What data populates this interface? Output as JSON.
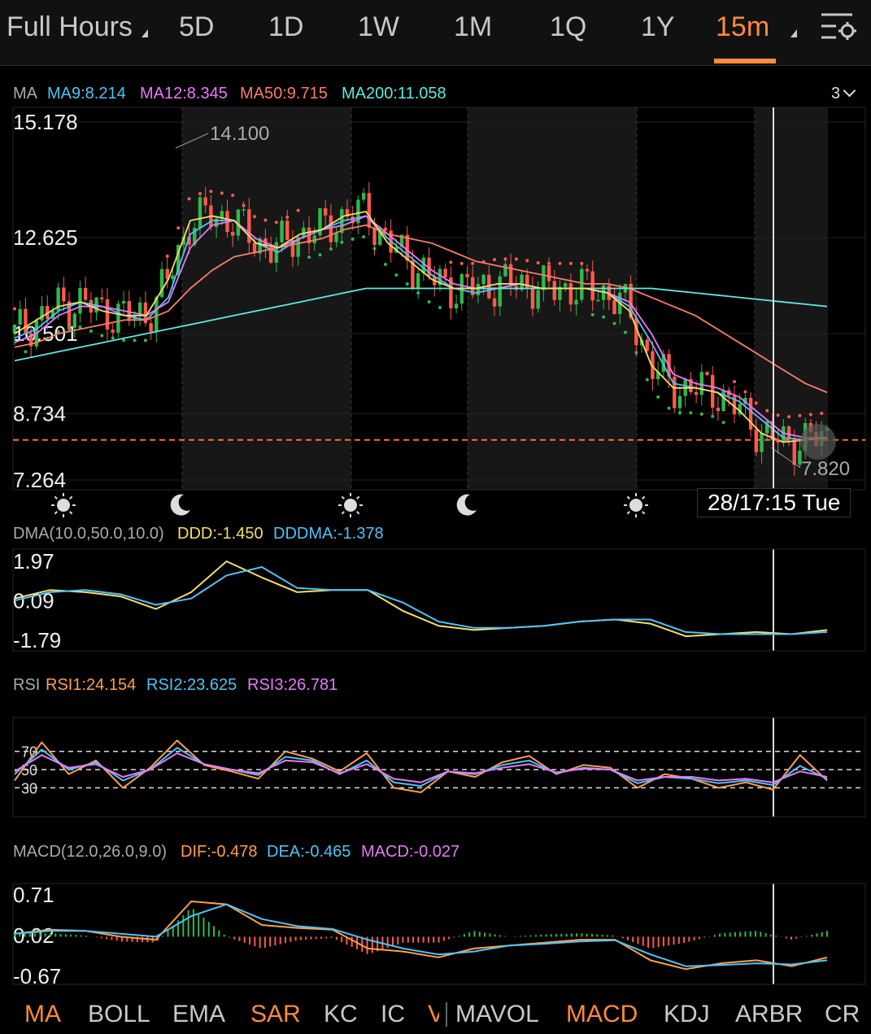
{
  "topbar": {
    "timeframes": [
      "Full Hours",
      "5D",
      "1D",
      "1W",
      "1M",
      "1Q",
      "1Y",
      "15m"
    ],
    "active": "15m",
    "accent": "#ff8a3d",
    "settings_icon": "settings-gear-icon"
  },
  "ma_panel": {
    "label": "MA",
    "ma9": "MA9:8.214",
    "ma12": "MA12:8.345",
    "ma50": "MA50:9.715",
    "ma200": "MA200:11.058",
    "toggle": "3",
    "high_label": "14.100",
    "low_label": "7.820",
    "crosshair_time": "28/17:15 Tue",
    "colors": {
      "ma9": "#4fc3f7",
      "ma12": "#e879f9",
      "ma50": "#ff7a6b",
      "ma200": "#5ee9e0",
      "yellow": "#f5dd6b"
    }
  },
  "session_icons": [
    "sun-icon",
    "moon-icon",
    "sun-icon",
    "moon-icon",
    "sun-icon"
  ],
  "dma_panel": {
    "label": "DMA(10.0,50.0,10.0)",
    "ddd": "DDD:-1.450",
    "dddma": "DDDMA:-1.378"
  },
  "rsi_panel": {
    "label": "RSI",
    "rsi1": "RSI1:24.154",
    "rsi2": "RSI2:23.625",
    "rsi3": "RSI3:26.781"
  },
  "macd_panel": {
    "label": "MACD(12.0,26.0,9.0)",
    "dif": "DIF:-0.478",
    "dea": "DEA:-0.465",
    "macd": "MACD:-0.027"
  },
  "bottom_tabs": [
    {
      "label": "MA",
      "active": true
    },
    {
      "label": "BOLL",
      "active": false
    },
    {
      "label": "EMA",
      "active": false
    },
    {
      "label": "SAR",
      "active": true
    },
    {
      "label": "KC",
      "active": false
    },
    {
      "label": "IC",
      "active": false
    },
    {
      "label": "V",
      "active": false
    },
    {
      "label": "MAVOL",
      "active": false
    },
    {
      "label": "MACD",
      "active": true
    },
    {
      "label": "KDJ",
      "active": false
    },
    {
      "label": "ARBR",
      "active": false
    },
    {
      "label": "CR",
      "active": false
    }
  ],
  "chart_data": [
    {
      "type": "line",
      "panel": "price",
      "ylim": [
        7.264,
        15.178
      ],
      "y_ticks": [
        "15.178",
        "12.625",
        "10.501",
        "8.734",
        "7.264"
      ],
      "current_price_line": 8.15,
      "series": [
        {
          "name": "MA9",
          "color": "#4fc3f7",
          "values": [
            10.4,
            10.6,
            11.0,
            11.2,
            11.1,
            10.9,
            10.8,
            11.3,
            12.7,
            13.0,
            13.0,
            12.5,
            12.3,
            12.6,
            12.8,
            13.0,
            13.1,
            12.6,
            12.2,
            11.8,
            11.5,
            11.4,
            11.5,
            11.6,
            11.5,
            11.5,
            11.5,
            11.4,
            11.1,
            10.3,
            9.4,
            9.3,
            9.2,
            9.0,
            8.6,
            8.2,
            8.15,
            8.2
          ]
        },
        {
          "name": "MA12",
          "color": "#e879f9",
          "values": [
            10.3,
            10.5,
            10.9,
            11.1,
            11.1,
            11.0,
            10.9,
            11.2,
            12.4,
            12.9,
            13.0,
            12.6,
            12.4,
            12.6,
            12.8,
            12.9,
            13.1,
            12.7,
            12.3,
            11.9,
            11.6,
            11.5,
            11.5,
            11.6,
            11.5,
            11.5,
            11.5,
            11.4,
            11.2,
            10.5,
            9.6,
            9.4,
            9.3,
            9.1,
            8.7,
            8.3,
            8.2,
            8.2
          ]
        },
        {
          "name": "MA50",
          "color": "#ff7a6b",
          "values": [
            10.2,
            10.3,
            10.5,
            10.6,
            10.7,
            10.8,
            10.8,
            11.0,
            11.5,
            11.9,
            12.2,
            12.3,
            12.4,
            12.5,
            12.6,
            12.8,
            12.9,
            12.7,
            12.6,
            12.5,
            12.3,
            12.1,
            12.0,
            11.9,
            11.8,
            11.7,
            11.6,
            11.6,
            11.5,
            11.3,
            11.1,
            10.9,
            10.6,
            10.3,
            10.0,
            9.7,
            9.4,
            9.2
          ]
        },
        {
          "name": "MA200",
          "color": "#5ee9e0",
          "values": [
            9.9,
            10.0,
            10.1,
            10.2,
            10.3,
            10.4,
            10.5,
            10.6,
            10.7,
            10.8,
            10.9,
            11.0,
            11.1,
            11.2,
            11.3,
            11.4,
            11.5,
            11.5,
            11.5,
            11.5,
            11.5,
            11.5,
            11.5,
            11.5,
            11.5,
            11.5,
            11.5,
            11.5,
            11.5,
            11.5,
            11.45,
            11.4,
            11.35,
            11.3,
            11.25,
            11.2,
            11.15,
            11.1
          ]
        },
        {
          "name": "MA",
          "color": "#f5dd6b",
          "values": [
            10.5,
            10.8,
            11.1,
            11.2,
            11.0,
            10.9,
            10.9,
            11.7,
            13.0,
            13.1,
            13.0,
            12.5,
            12.4,
            12.7,
            12.8,
            13.1,
            13.2,
            12.5,
            12.1,
            11.7,
            11.5,
            11.5,
            11.6,
            11.6,
            11.5,
            11.5,
            11.5,
            11.4,
            11.0,
            9.8,
            9.3,
            9.3,
            9.2,
            8.8,
            8.3,
            8.1,
            8.15,
            8.2
          ]
        }
      ]
    },
    {
      "type": "line",
      "panel": "DMA",
      "ylim": [
        -1.79,
        1.97
      ],
      "y_ticks": [
        "1.97",
        "0.09",
        "-1.79"
      ],
      "series": [
        {
          "name": "DDD",
          "color": "#f5dd6b",
          "values": [
            0.2,
            0.6,
            0.5,
            0.3,
            -0.3,
            0.5,
            1.97,
            1.2,
            0.5,
            0.6,
            0.6,
            -0.4,
            -1.1,
            -1.3,
            -1.2,
            -1.1,
            -0.9,
            -0.8,
            -1.0,
            -1.6,
            -1.5,
            -1.4,
            -1.5,
            -1.3
          ]
        },
        {
          "name": "DDDMA",
          "color": "#4fc3f7",
          "values": [
            0.1,
            0.5,
            0.6,
            0.4,
            -0.1,
            0.2,
            1.3,
            1.7,
            0.7,
            0.6,
            0.6,
            0.0,
            -0.9,
            -1.2,
            -1.2,
            -1.1,
            -0.9,
            -0.8,
            -0.8,
            -1.4,
            -1.5,
            -1.5,
            -1.5,
            -1.4
          ]
        }
      ]
    },
    {
      "type": "line",
      "panel": "RSI",
      "y_ticks": [
        "70",
        "50",
        "30"
      ],
      "ylim": [
        0,
        100
      ],
      "series": [
        {
          "name": "RSI1",
          "color": "#ff9f4a",
          "values": [
            38,
            80,
            45,
            60,
            30,
            52,
            82,
            55,
            48,
            40,
            70,
            62,
            48,
            68,
            30,
            25,
            48,
            42,
            58,
            65,
            45,
            55,
            52,
            30,
            45,
            40,
            30,
            36,
            28,
            66,
            38
          ]
        },
        {
          "name": "RSI2",
          "color": "#4fc3f7",
          "values": [
            45,
            72,
            50,
            58,
            38,
            50,
            74,
            56,
            50,
            44,
            64,
            60,
            45,
            60,
            36,
            32,
            48,
            45,
            55,
            60,
            46,
            52,
            50,
            35,
            42,
            40,
            35,
            38,
            33,
            54,
            40
          ]
        },
        {
          "name": "RSI3",
          "color": "#e879f9",
          "values": [
            48,
            66,
            52,
            56,
            42,
            50,
            68,
            56,
            50,
            46,
            60,
            58,
            46,
            56,
            40,
            36,
            48,
            46,
            52,
            56,
            47,
            51,
            50,
            38,
            42,
            42,
            38,
            40,
            36,
            48,
            42
          ]
        }
      ]
    },
    {
      "type": "bar",
      "panel": "MACD",
      "ylim": [
        -0.67,
        0.71
      ],
      "y_ticks": [
        "0.71",
        "0.02",
        "-0.67"
      ],
      "series": [
        {
          "name": "DIF",
          "color": "#ff9f4a",
          "values": [
            0.05,
            0.12,
            0.1,
            0.0,
            -0.05,
            0.6,
            0.55,
            0.2,
            0.15,
            0.12,
            -0.2,
            -0.25,
            -0.35,
            -0.2,
            -0.15,
            -0.1,
            -0.05,
            -0.05,
            -0.4,
            -0.55,
            -0.45,
            -0.4,
            -0.5,
            -0.35
          ]
        },
        {
          "name": "DEA",
          "color": "#4fc3f7",
          "values": [
            0.05,
            0.1,
            0.1,
            0.05,
            0.0,
            0.35,
            0.55,
            0.3,
            0.18,
            0.13,
            -0.05,
            -0.2,
            -0.3,
            -0.25,
            -0.15,
            -0.12,
            -0.08,
            -0.06,
            -0.3,
            -0.5,
            -0.48,
            -0.45,
            -0.47,
            -0.4
          ]
        },
        {
          "name": "MACD",
          "color": "#e879f9",
          "values": [
            0.05,
            0.06,
            0.02,
            -0.08,
            -0.1,
            0.5,
            0.0,
            -0.2,
            -0.06,
            -0.02,
            -0.3,
            -0.1,
            -0.1,
            0.1,
            0.0,
            0.04,
            0.06,
            0.02,
            -0.2,
            -0.1,
            0.06,
            0.1,
            -0.05,
            0.1
          ]
        }
      ]
    }
  ]
}
